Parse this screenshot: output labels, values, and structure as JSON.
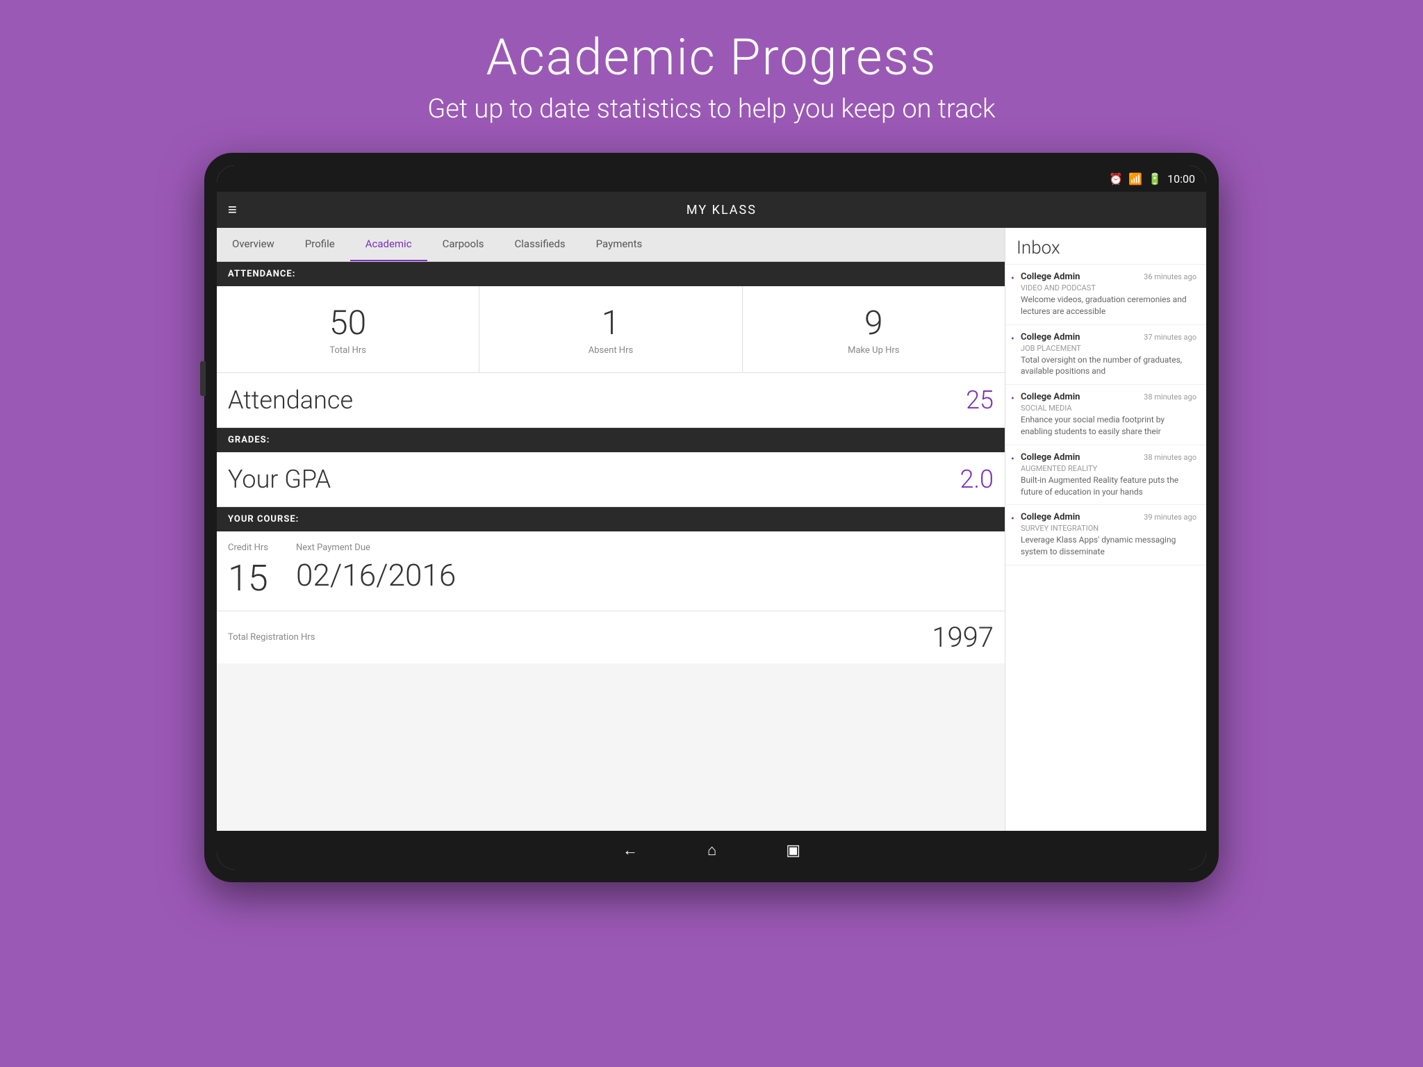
{
  "page": {
    "title": "Academic Progress",
    "subtitle": "Get up to date statistics to help you keep on track"
  },
  "statusBar": {
    "time": "10:00",
    "icons": [
      "alarm-icon",
      "wifi-icon",
      "battery-icon"
    ]
  },
  "appBar": {
    "title": "MY KLASS",
    "menuIcon": "≡"
  },
  "tabs": [
    {
      "label": "Overview",
      "active": false
    },
    {
      "label": "Profile",
      "active": false
    },
    {
      "label": "Academic",
      "active": true
    },
    {
      "label": "Carpools",
      "active": false
    },
    {
      "label": "Classifieds",
      "active": false
    },
    {
      "label": "Payments",
      "active": false
    }
  ],
  "sections": {
    "attendance": {
      "header": "ATTENDANCE:",
      "stats": [
        {
          "value": "50",
          "label": "Total Hrs"
        },
        {
          "value": "1",
          "label": "Absent Hrs"
        },
        {
          "value": "9",
          "label": "Make Up Hrs"
        }
      ],
      "scoreLabel": "Attendance",
      "scoreValue": "25"
    },
    "grades": {
      "header": "GRADES:",
      "scoreLabel": "Your GPA",
      "scoreValue": "2.0"
    },
    "course": {
      "header": "YOUR COURSE:",
      "creditLabel": "Credit Hrs",
      "creditValue": "15",
      "paymentLabel": "Next Payment Due",
      "paymentValue": "02/16/2016",
      "totalLabel": "Total Registration Hrs",
      "totalValue": "1997"
    }
  },
  "inbox": {
    "title": "Inbox",
    "items": [
      {
        "sender": "College Admin",
        "time": "36 minutes ago",
        "category": "VIDEO AND PODCAST",
        "preview": "Welcome videos, graduation ceremonies and lectures are accessible"
      },
      {
        "sender": "College Admin",
        "time": "37 minutes ago",
        "category": "JOB PLACEMENT",
        "preview": "Total oversight on the number of graduates, available positions and"
      },
      {
        "sender": "College Admin",
        "time": "38 minutes ago",
        "category": "SOCIAL MEDIA",
        "preview": "Enhance your social media footprint by enabling students to easily share their"
      },
      {
        "sender": "College Admin",
        "time": "38 minutes ago",
        "category": "AUGMENTED REALITY",
        "preview": "Built-in Augmented Reality feature puts the future of education in your hands"
      },
      {
        "sender": "College Admin",
        "time": "39 minutes ago",
        "category": "SURVEY INTEGRATION",
        "preview": "Leverage Klass Apps' dynamic messaging system to disseminate"
      }
    ]
  },
  "bottomNav": {
    "backIcon": "←",
    "homeIcon": "⌂",
    "recentIcon": "▣"
  }
}
